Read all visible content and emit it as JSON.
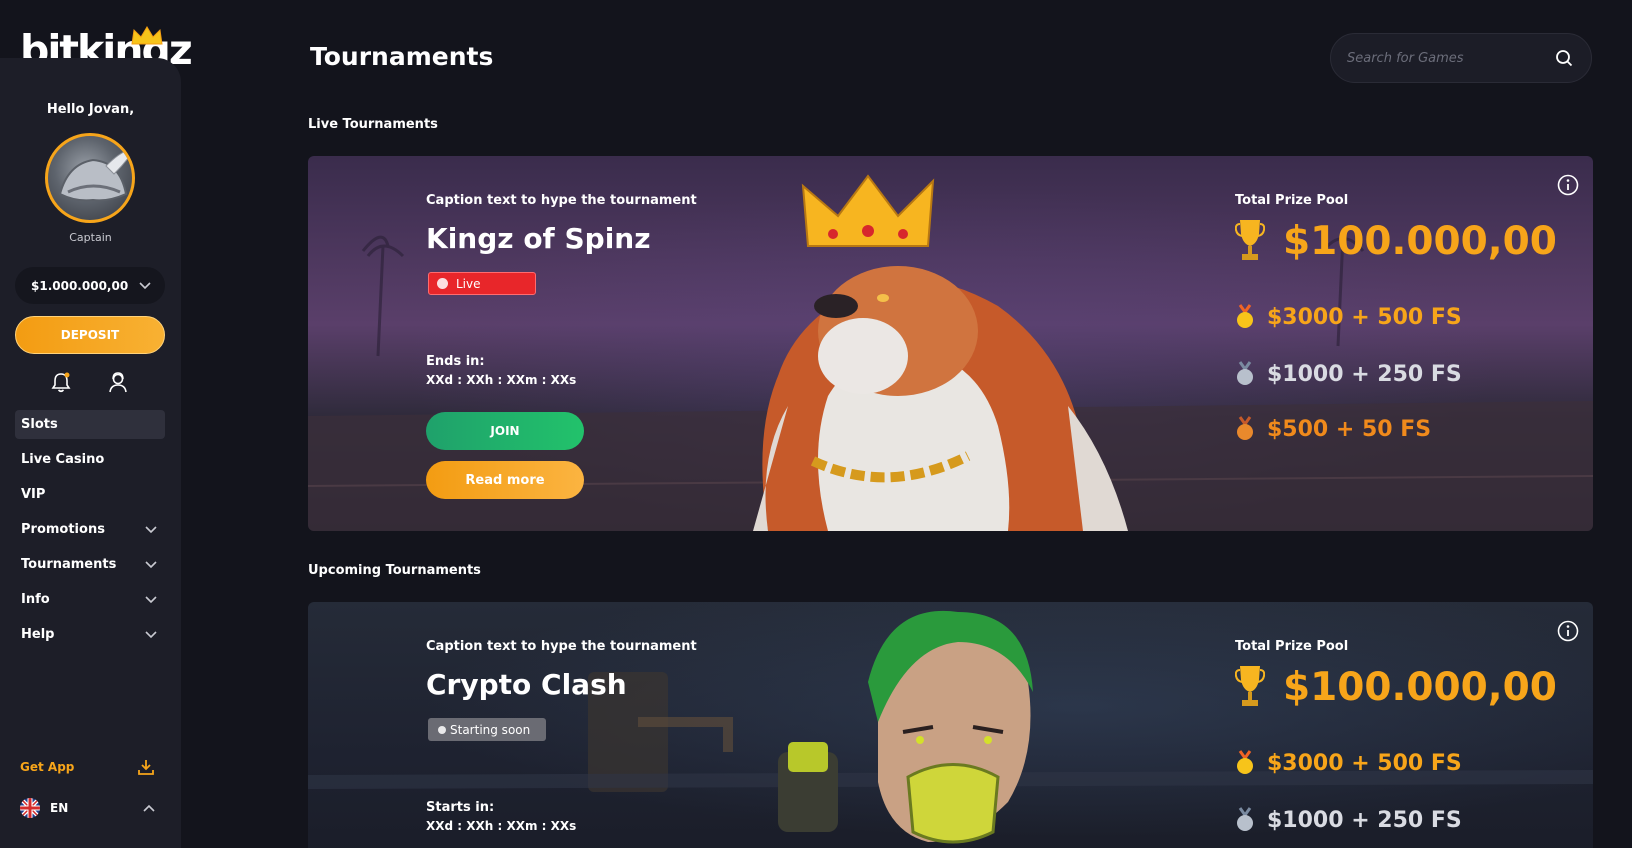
{
  "brand": {
    "logo_text": "bitkingz",
    "accent": "#f7a51a"
  },
  "sidebar": {
    "greeting": "Hello Jovan,",
    "rank": "Captain",
    "balance": "$1.000.000,00",
    "deposit_label": "DEPOSIT",
    "icons": [
      "bell-icon",
      "support-agent-icon"
    ],
    "nav": [
      {
        "label": "Slots",
        "active": true,
        "expandable": false
      },
      {
        "label": "Live Casino",
        "expandable": false
      },
      {
        "label": "VIP",
        "expandable": false
      },
      {
        "label": "Promotions",
        "expandable": true
      },
      {
        "label": "Tournaments",
        "expandable": true
      },
      {
        "label": "Info",
        "expandable": true
      },
      {
        "label": "Help",
        "expandable": true
      }
    ],
    "get_app": "Get App",
    "language": "EN"
  },
  "header": {
    "title": "Tournaments",
    "search_placeholder": "Search for Games"
  },
  "sections": {
    "live_title": "Live Tournaments",
    "upcoming_title": "Upcoming Tournaments"
  },
  "live_tournament": {
    "caption": "Caption text to hype the tournament",
    "name": "Kingz of Spinz",
    "status": "Live",
    "timer_label": "Ends in:",
    "timer_value": "XXd : XXh : XXm : XXs",
    "join_label": "JOIN",
    "read_more_label": "Read more",
    "prize_label": "Total Prize Pool",
    "prize_pool": "$100.000,00",
    "prizes": [
      "$3000 + 500 FS",
      "$1000 + 250 FS",
      "$500 + 50 FS"
    ]
  },
  "upcoming_tournament": {
    "caption": "Caption text to hype the tournament",
    "name": "Crypto Clash",
    "status": "Starting soon",
    "timer_label": "Starts in:",
    "timer_value": "XXd : XXh : XXm : XXs",
    "prize_label": "Total Prize Pool",
    "prize_pool": "$100.000,00",
    "prizes": [
      "$3000 + 500 FS",
      "$1000 + 250 FS"
    ]
  }
}
